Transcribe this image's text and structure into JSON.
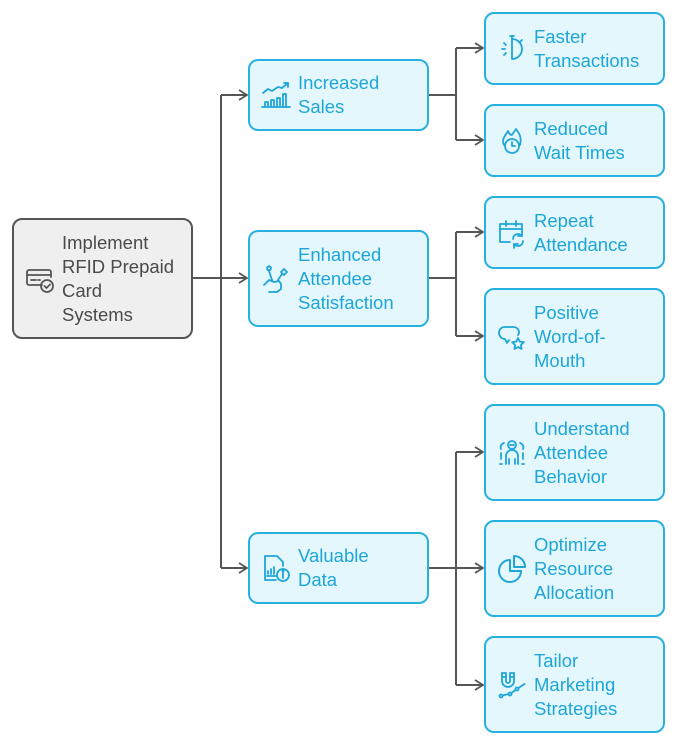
{
  "diagram": {
    "root": {
      "label": "Implement\nRFID Prepaid\nCard\nSystems",
      "icon": "card-check-icon"
    },
    "level1": [
      {
        "label": "Increased\nSales",
        "icon": "sales-growth-chart-icon"
      },
      {
        "label": "Enhanced\nAttendee\nSatisfaction",
        "icon": "hand-satisfaction-icon"
      },
      {
        "label": "Valuable\nData",
        "icon": "data-info-icon"
      }
    ],
    "level2": [
      {
        "label": "Faster\nTransactions",
        "icon": "stopwatch-icon",
        "parent": 0
      },
      {
        "label": "Reduced\nWait Times",
        "icon": "fire-clock-icon",
        "parent": 0
      },
      {
        "label": "Repeat\nAttendance",
        "icon": "calendar-repeat-icon",
        "parent": 1
      },
      {
        "label": "Positive\nWord-of-\nMouth",
        "icon": "speech-star-icon",
        "parent": 1
      },
      {
        "label": "Understand\nAttendee\nBehavior",
        "icon": "person-analysis-icon",
        "parent": 2
      },
      {
        "label": "Optimize\nResource\nAllocation",
        "icon": "pie-chart-icon",
        "parent": 2
      },
      {
        "label": "Tailor\nMarketing\nStrategies",
        "icon": "magnet-marketing-icon",
        "parent": 2
      }
    ],
    "colors": {
      "child_fill": "#e3f7fd",
      "child_border": "#28b0e0",
      "child_text": "#1ea6d8",
      "root_fill": "#efefef",
      "root_border": "#555555",
      "connector": "#555555"
    }
  }
}
